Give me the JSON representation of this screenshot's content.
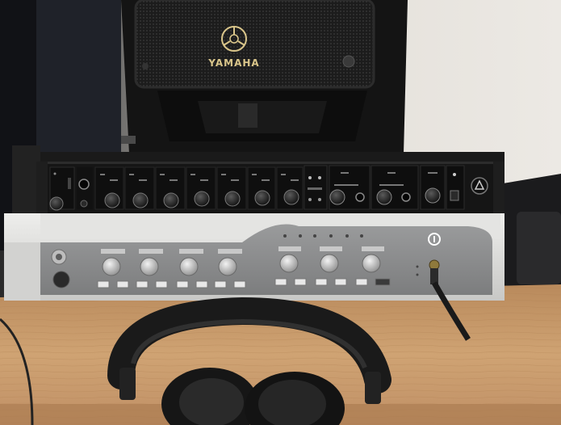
{
  "photo": {
    "subject": "studio-desk-with-audio-gear",
    "speaker": {
      "brand_label": "YAMAHA",
      "logo_icon": "yamaha-tuning-fork-logo-icon"
    },
    "preamp_rack": {
      "channel_count": 8,
      "headphone_outputs": 2,
      "logo_icon": "triangle-logo-icon"
    },
    "audio_interface": {
      "mic_preamp_knobs": 4,
      "output_knobs": 3,
      "logo_icon": "digi-logo-icon"
    },
    "colors": {
      "wall": "#e6e2dc",
      "desk": "#c89a6a",
      "rack_black": "#151515",
      "interface_silver": "#d8d8d6",
      "interface_panel": "#8c8d8e",
      "logo_gold": "#d9c58a"
    }
  }
}
